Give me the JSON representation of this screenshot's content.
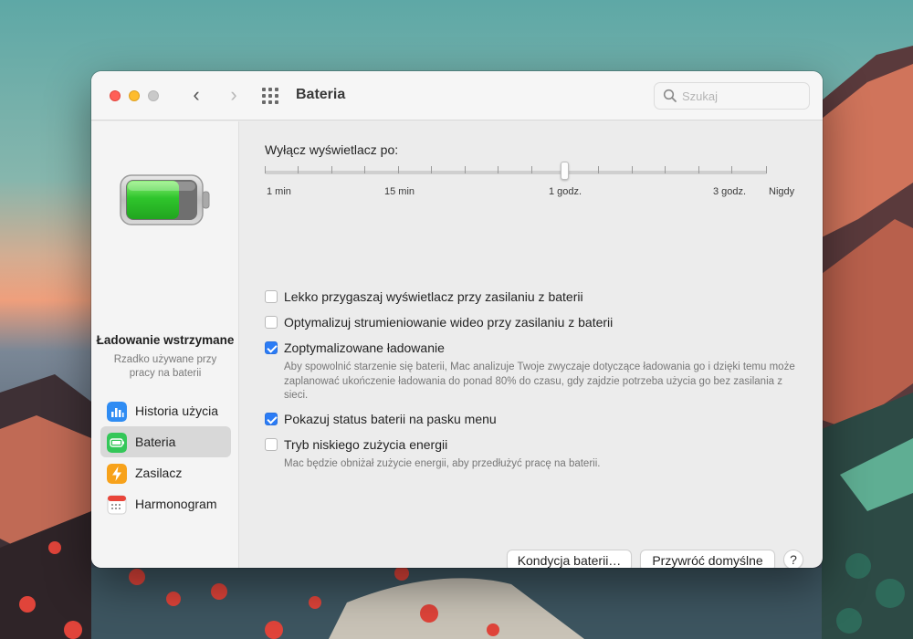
{
  "window": {
    "title": "Bateria",
    "search_placeholder": "Szukaj"
  },
  "sidebar": {
    "status_title": "Ładowanie wstrzymane",
    "status_subtitle": "Rzadko używane przy pracy na baterii",
    "battery_level": 0.75,
    "items": [
      {
        "label": "Historia użycia",
        "icon": "bar-chart-icon",
        "color": "#2f8cf3",
        "selected": false
      },
      {
        "label": "Bateria",
        "icon": "battery-icon",
        "color": "#34c759",
        "selected": true
      },
      {
        "label": "Zasilacz",
        "icon": "lightning-icon",
        "color": "#f7a21b",
        "selected": false
      },
      {
        "label": "Harmonogram",
        "icon": "calendar-icon",
        "color": "#e9453a",
        "selected": false
      }
    ]
  },
  "display_off": {
    "label": "Wyłącz wyświetlacz po:",
    "ticks": [
      "1 min",
      "15 min",
      "1 godz.",
      "3 godz.",
      "Nigdy"
    ],
    "value": "1 godz."
  },
  "options": [
    {
      "label": "Lekko przygaszaj wyświetlacz przy zasilaniu z baterii",
      "checked": false
    },
    {
      "label": "Optymalizuj strumieniowanie wideo przy zasilaniu z baterii",
      "checked": false
    },
    {
      "label": "Zoptymalizowane ładowanie",
      "checked": true,
      "description": "Aby spowolnić starzenie się baterii, Mac analizuje Twoje zwyczaje dotyczące ładowania go i dzięki temu może zaplanować ukończenie ładowania do ponad 80% do czasu, gdy zajdzie potrzeba użycia go bez zasilania z sieci."
    },
    {
      "label": "Pokazuj status baterii na pasku menu",
      "checked": true
    },
    {
      "label": "Tryb niskiego zużycia energii",
      "checked": false,
      "description": "Mac będzie obniżał zużycie energii, aby przedłużyć pracę na baterii."
    }
  ],
  "buttons": {
    "battery_health": "Kondycja baterii…",
    "restore_defaults": "Przywróć domyślne",
    "help": "?"
  },
  "colors": {
    "accent": "#2b7cf6",
    "battery_green": "#3dd13a"
  }
}
